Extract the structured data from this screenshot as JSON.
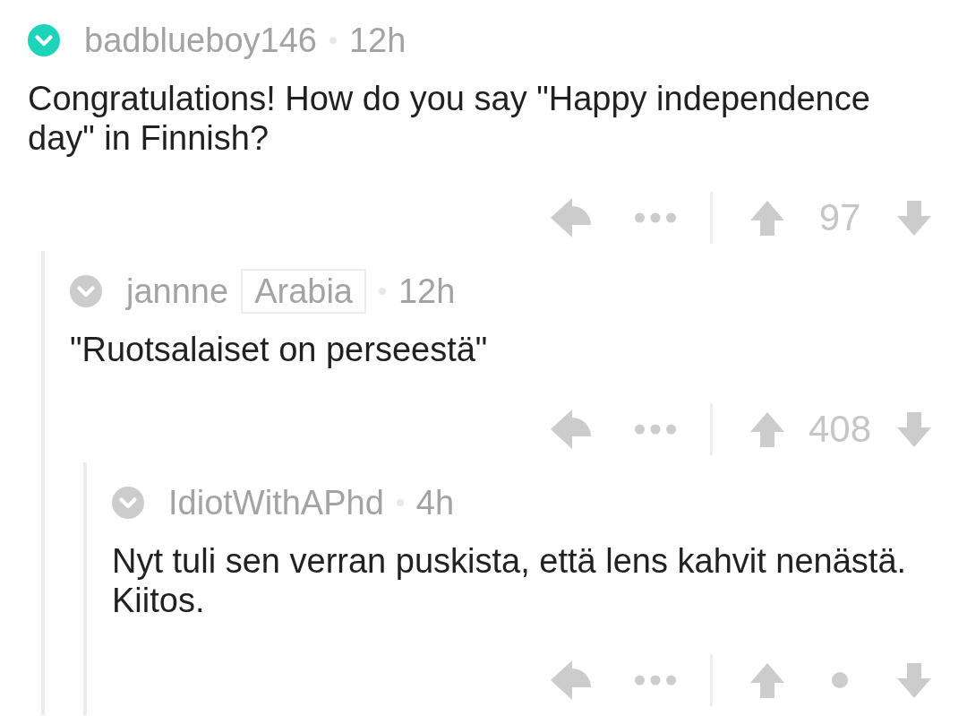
{
  "comments": [
    {
      "author": "badblueboy146",
      "avatar": {
        "color": "#1dd3b9"
      },
      "time": "12h",
      "body": "Congratulations! How do you say \"Happy independence day\" in Finnish?",
      "score": "97",
      "score_hidden": false,
      "children": [
        {
          "author": "jannne",
          "avatar": {
            "color": "#cccccc"
          },
          "flair": "Arabia",
          "time": "12h",
          "body": "\"Ruotsalaiset on perseestä\"",
          "score": "408",
          "score_hidden": false,
          "children": [
            {
              "author": "IdiotWithAPhd",
              "avatar": {
                "color": "#cccccc"
              },
              "time": "4h",
              "body": "Nyt tuli sen verran puskista, että lens kahvit nenästä. Kiitos.",
              "score_hidden": true
            }
          ]
        }
      ]
    }
  ]
}
